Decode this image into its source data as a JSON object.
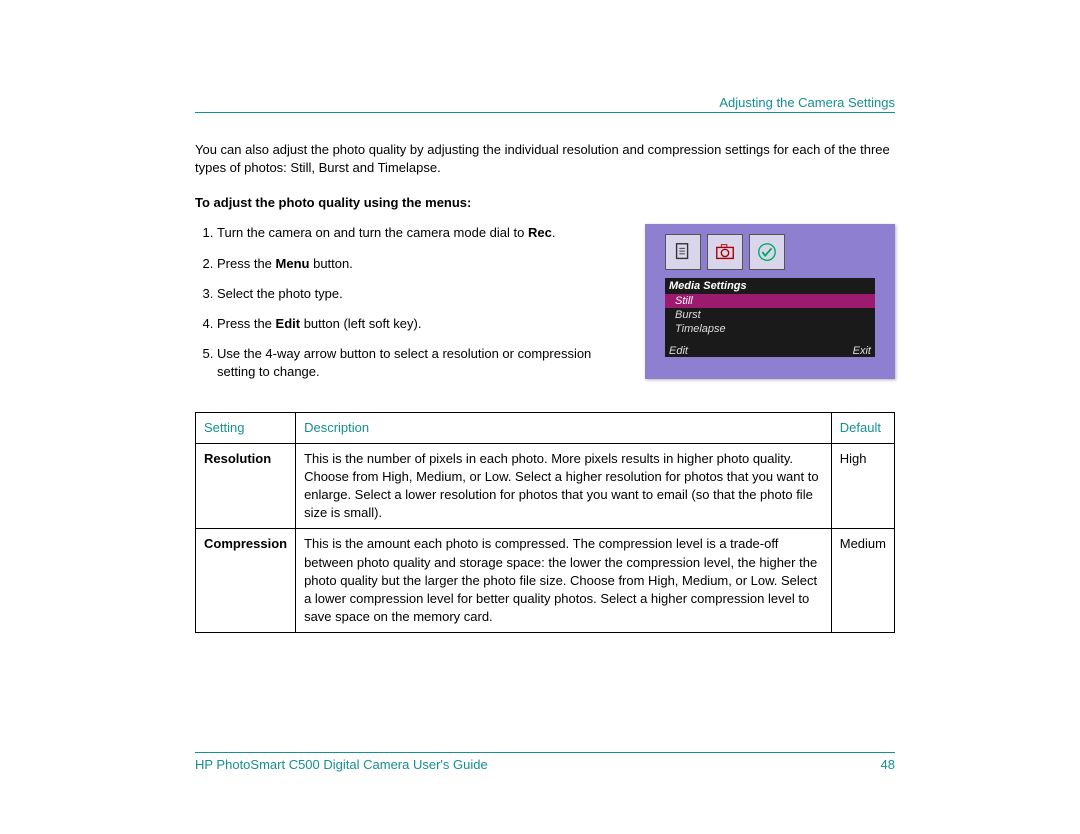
{
  "header": {
    "section_title": "Adjusting the Camera Settings"
  },
  "intro": "You can also adjust the photo quality by adjusting the individual resolution and compression settings for each of the three types of photos: Still, Burst and Timelapse.",
  "procedure_title": "To adjust the photo quality using the menus:",
  "steps": {
    "s1_a": "Turn the camera on and turn the camera mode dial to ",
    "s1_b": "Rec",
    "s1_c": ".",
    "s2_a": "Press the ",
    "s2_b": "Menu",
    "s2_c": " button.",
    "s3": "Select the photo type.",
    "s4_a": "Press the ",
    "s4_b": "Edit",
    "s4_c": " button (left soft key).",
    "s5": "Use the 4-way arrow button to select a resolution or compression setting to change."
  },
  "screen": {
    "menu_title": "Media Settings",
    "item1": "Still",
    "item2": "Burst",
    "item3": "Timelapse",
    "soft_left": "Edit",
    "soft_right": "Exit"
  },
  "table": {
    "h1": "Setting",
    "h2": "Description",
    "h3": "Default",
    "rows": [
      {
        "name": "Resolution",
        "desc": "This is the number of pixels in each photo. More pixels results in higher photo quality. Choose from High, Medium, or Low. Select a higher resolution for photos that you want to enlarge. Select a lower resolution for photos that you want to email (so that the photo file size is small).",
        "def": "High"
      },
      {
        "name": "Compression",
        "desc": "This is the amount each photo is compressed. The compression level is a trade-off between photo quality and storage space: the lower the compression level, the higher the photo quality but the larger the photo file size. Choose from High, Medium, or Low. Select a lower compression level for better quality photos. Select a higher compression level to save space on the memory card.",
        "def": "Medium"
      }
    ]
  },
  "footer": {
    "guide": "HP PhotoSmart C500 Digital Camera User's Guide",
    "page": "48"
  }
}
